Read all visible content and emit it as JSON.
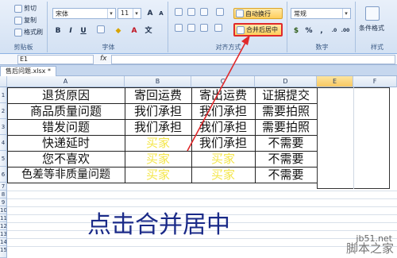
{
  "ribbon": {
    "clipboard": {
      "cut": "剪切",
      "copy": "复制",
      "format_painter": "格式刷",
      "label": "剪贴板"
    },
    "font": {
      "font_name": "宋体",
      "font_size": "11",
      "label": "字体"
    },
    "alignment": {
      "wrap_text": "自动换行",
      "merge_center": "合并后居中",
      "label": "对齐方式"
    },
    "number": {
      "format": "常规",
      "label": "数字"
    },
    "styles": {
      "conditional_format": "条件格式",
      "label": "样式"
    }
  },
  "formula_bar": {
    "name_box": "E1",
    "fx": "fx"
  },
  "tab": {
    "filename": "售后问题.xlsx *"
  },
  "columns": [
    "A",
    "B",
    "C",
    "D",
    "E",
    "F"
  ],
  "rows": [
    "1",
    "2",
    "3",
    "4",
    "5",
    "6",
    "7",
    "8",
    "9",
    "10",
    "11",
    "12",
    "13",
    "14",
    "15"
  ],
  "table": [
    [
      "退货原因",
      "寄回运费",
      "寄出运费",
      "证据提交"
    ],
    [
      "商品质量问题",
      "我们承担",
      "我们承担",
      "需要拍照"
    ],
    [
      "错发问题",
      "我们承担",
      "我们承担",
      "需要拍照"
    ],
    [
      "快递延时",
      "买家",
      "我们承担",
      "不需要"
    ],
    [
      "您不喜欢",
      "买家",
      "买家",
      "不需要"
    ],
    [
      "色差等非质量问题",
      "买家",
      "买家",
      "不需要"
    ]
  ],
  "caption": "点击合并居中",
  "watermark": {
    "site": "jb51.net",
    "brand": "脚本之家"
  },
  "colors": {
    "highlight_border": "#e0292b",
    "yellow_text": "#f4e64a",
    "caption": "#1a2a88"
  }
}
